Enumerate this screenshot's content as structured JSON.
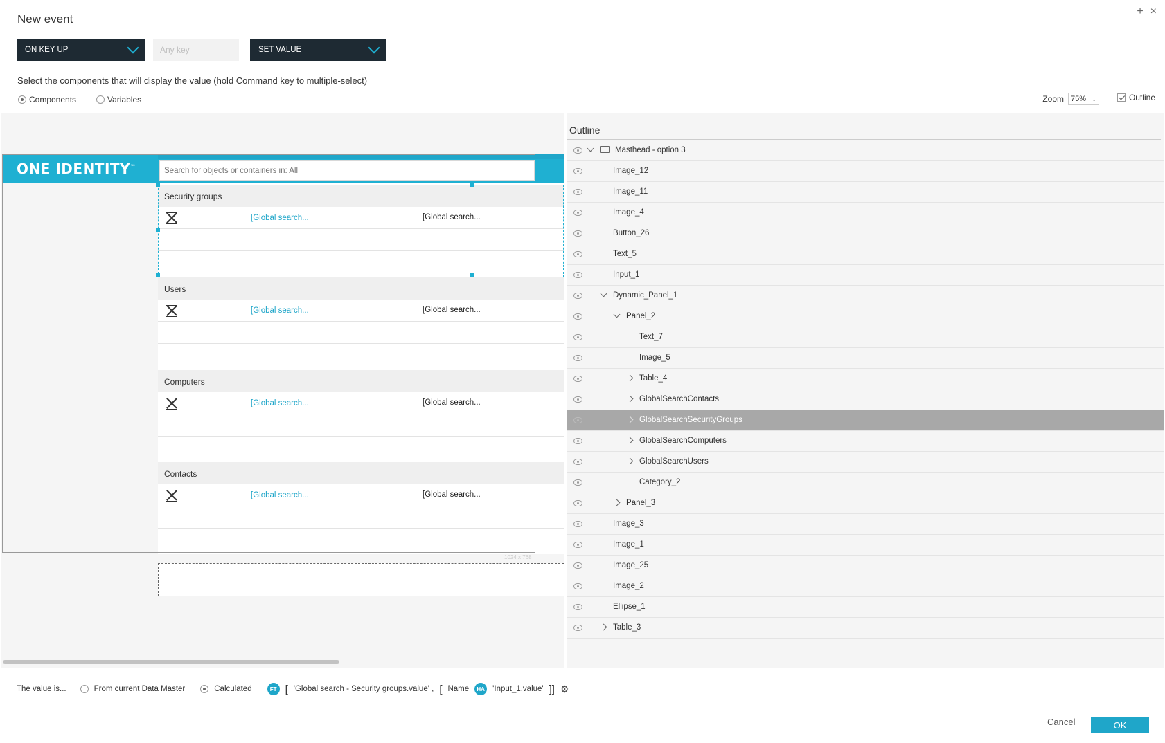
{
  "dialog": {
    "title": "New event",
    "add_label": "+",
    "close_label": "×"
  },
  "event": {
    "trigger": "ON KEY UP",
    "key_placeholder": "Any key",
    "action": "SET VALUE"
  },
  "instruction": "Select the components that will display the value (hold Command key to multiple-select)",
  "target_type": {
    "components_label": "Components",
    "variables_label": "Variables",
    "selected": "Components"
  },
  "zoom": {
    "label": "Zoom",
    "value": "75%"
  },
  "outline_toggle": {
    "label": "Outline",
    "checked": true
  },
  "canvas": {
    "logo": "ONE IDENTITY",
    "logo_tm": "™",
    "search_placeholder": "Search for objects or containers in: All",
    "size_label": "1024 x 768",
    "categories": [
      {
        "title": "Security groups",
        "link": "[Global search...",
        "value": "[Global search..."
      },
      {
        "title": "Users",
        "link": "[Global search...",
        "value": "[Global search..."
      },
      {
        "title": "Computers",
        "link": "[Global search...",
        "value": "[Global search..."
      },
      {
        "title": "Contacts",
        "link": "[Global search...",
        "value": "[Global search..."
      }
    ]
  },
  "outline": {
    "title": "Outline",
    "items": [
      {
        "label": "Masthead - option 3",
        "depth": 0,
        "toggle": "down",
        "icon": "monitor-icon"
      },
      {
        "label": "Image_12",
        "depth": 1,
        "toggle": ""
      },
      {
        "label": "Image_11",
        "depth": 1,
        "toggle": ""
      },
      {
        "label": "Image_4",
        "depth": 1,
        "toggle": ""
      },
      {
        "label": "Button_26",
        "depth": 1,
        "toggle": ""
      },
      {
        "label": "Text_5",
        "depth": 1,
        "toggle": ""
      },
      {
        "label": "Input_1",
        "depth": 1,
        "toggle": ""
      },
      {
        "label": "Dynamic_Panel_1",
        "depth": 1,
        "toggle": "down"
      },
      {
        "label": "Panel_2",
        "depth": 2,
        "toggle": "down"
      },
      {
        "label": "Text_7",
        "depth": 3,
        "toggle": ""
      },
      {
        "label": "Image_5",
        "depth": 3,
        "toggle": ""
      },
      {
        "label": "Table_4",
        "depth": 3,
        "toggle": "right"
      },
      {
        "label": "GlobalSearchContacts",
        "depth": 3,
        "toggle": "right"
      },
      {
        "label": "GlobalSearchSecurityGroups",
        "depth": 3,
        "toggle": "right",
        "selected": true
      },
      {
        "label": "GlobalSearchComputers",
        "depth": 3,
        "toggle": "right"
      },
      {
        "label": "GlobalSearchUsers",
        "depth": 3,
        "toggle": "right"
      },
      {
        "label": "Category_2",
        "depth": 3,
        "toggle": ""
      },
      {
        "label": "Panel_3",
        "depth": 2,
        "toggle": "right"
      },
      {
        "label": "Image_3",
        "depth": 1,
        "toggle": ""
      },
      {
        "label": "Image_1",
        "depth": 1,
        "toggle": ""
      },
      {
        "label": "Image_25",
        "depth": 1,
        "toggle": ""
      },
      {
        "label": "Image_2",
        "depth": 1,
        "toggle": ""
      },
      {
        "label": "Ellipse_1",
        "depth": 1,
        "toggle": ""
      },
      {
        "label": "Table_3",
        "depth": 1,
        "toggle": "right"
      }
    ]
  },
  "value": {
    "label": "The value is...",
    "option_master": "From current Data Master",
    "option_calculated": "Calculated",
    "selected": "Calculated",
    "badge1": "FT",
    "expr1": "'Global search - Security groups.value' ,",
    "open_bracket": "[",
    "name_label": "Name",
    "badge2": "HA",
    "expr2": "'Input_1.value'",
    "close_brackets": "]]",
    "gear": "⚙"
  },
  "buttons": {
    "cancel": "Cancel",
    "ok": "OK"
  },
  "colors": {
    "accent": "#1fb0d2",
    "dark_dropdown": "#1e2a33",
    "selected_row": "#a8a8a8"
  }
}
